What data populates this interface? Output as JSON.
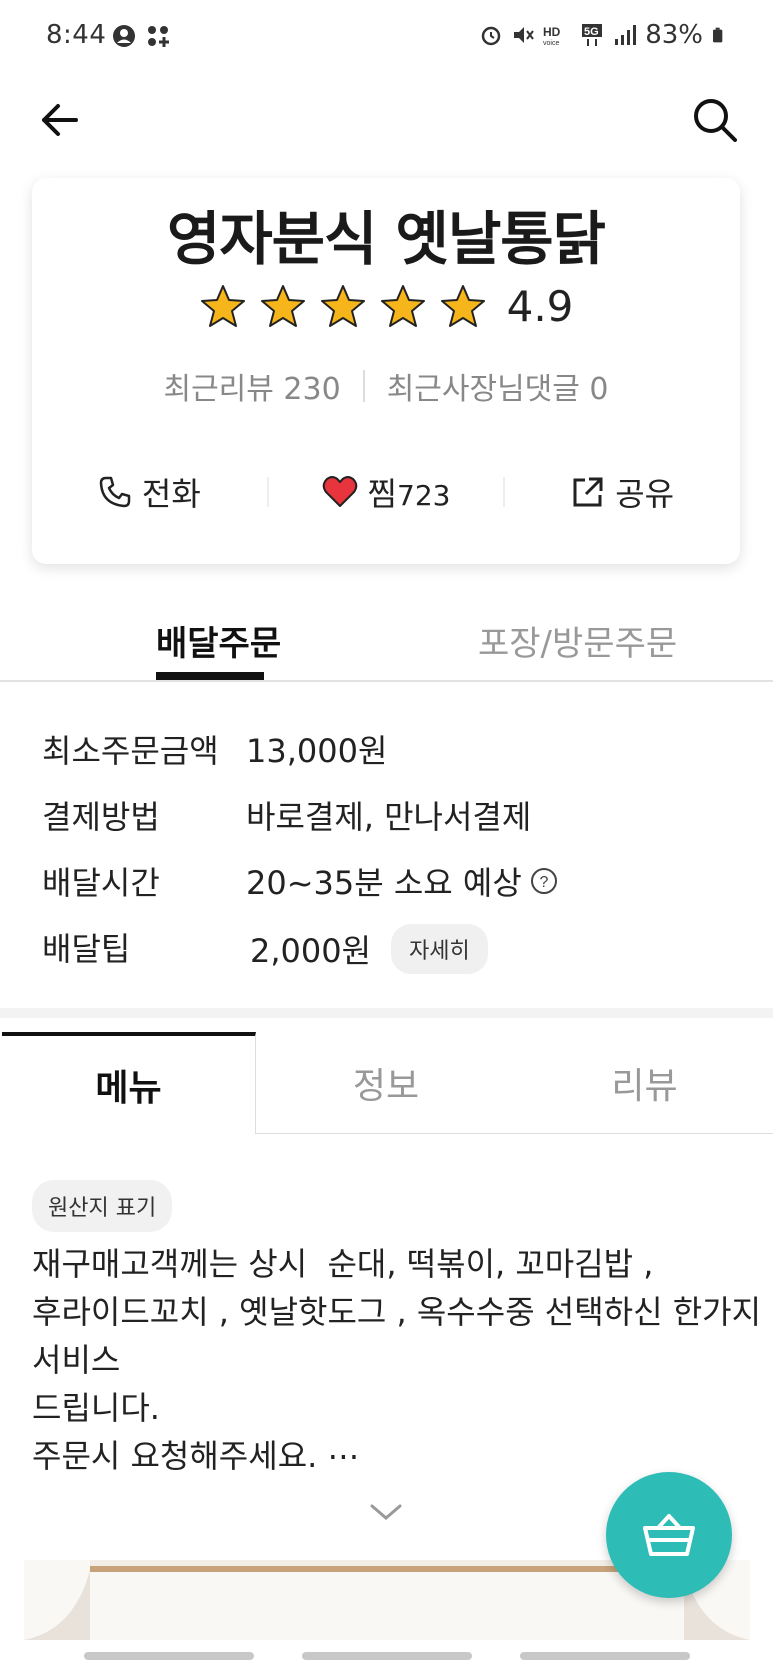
{
  "status_bar": {
    "time": "8:44",
    "battery": "83%",
    "icons": [
      "account-circle-icon",
      "grid-dots-icon",
      "alarm-icon",
      "mute-icon",
      "hd-voice-icon",
      "5g-icon",
      "signal-icon",
      "battery-icon"
    ]
  },
  "store": {
    "name": "영자분식 옛날통닭",
    "rating": "4.9",
    "star_count": 5,
    "recent_reviews": "최근리뷰 230",
    "owner_replies": "최근사장님댓글 0",
    "actions": {
      "call": "전화",
      "favorite": "찜",
      "favorite_count": "723",
      "share": "공유"
    }
  },
  "order_tabs": {
    "delivery": "배달주문",
    "pickup": "포장/방문주문"
  },
  "info": {
    "min_order_label": "최소주문금액",
    "min_order_value": "13,000원",
    "payment_label": "결제방법",
    "payment_value": "바로결제, 만나서결제",
    "delivery_time_label": "배달시간",
    "delivery_time_value": "20~35분 소요 예상",
    "delivery_tip_label": "배달팁",
    "delivery_tip_value": "2,000원",
    "detail_button": "자세히"
  },
  "main_tabs": {
    "menu": "메뉴",
    "info": "정보",
    "review": "리뷰"
  },
  "origin_label": "원산지 표기",
  "notice_lines": [
    "재구매고객께는 상시  순대, 떡볶이, 꼬마김밥 ,",
    "후라이드꼬치 , 옛날핫도그 , 옥수수중 선택하신 한가지",
    "서비스",
    "드립니다.",
    "주문시 요청해주세요. ⋯"
  ],
  "colors": {
    "accent_teal": "#2ebcb6",
    "star_yellow": "#f7b51c",
    "heart_red": "#e8343c"
  }
}
